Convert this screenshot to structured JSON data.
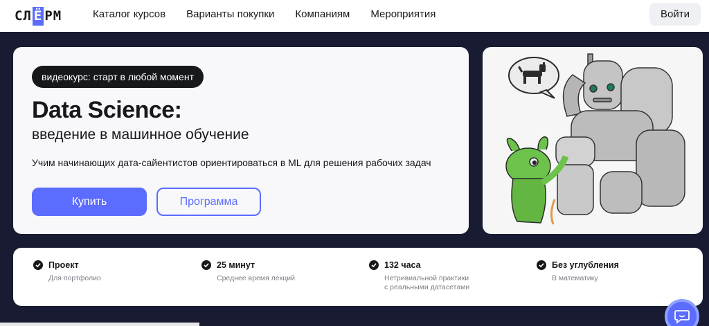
{
  "header": {
    "logo": {
      "pre": "СЛ",
      "hl": "Ё",
      "post": "РМ"
    },
    "nav": [
      "Каталог курсов",
      "Варианты покупки",
      "Компаниям",
      "Мероприятия"
    ],
    "login_label": "Войти"
  },
  "hero": {
    "badge": "видеокурс: старт в любой момент",
    "title": "Data Science:",
    "subtitle": "введение в машинное обучение",
    "description": "Учим начинающих дата-сайентистов ориентироваться в ML для решения рабочих задач",
    "buy_label": "Купить",
    "program_label": "Программа"
  },
  "features": [
    {
      "title": "Проект",
      "line1": "Для портфолио",
      "line2": ""
    },
    {
      "title": "25 минут",
      "line1": "Среднее время лекций",
      "line2": ""
    },
    {
      "title": "132 часа",
      "line1": "Нетривиальной практики",
      "line2": "с реальными датасетами"
    },
    {
      "title": "Без углубления",
      "line1": "В математику",
      "line2": ""
    }
  ],
  "colors": {
    "accent": "#5b6cff",
    "dark": "#181b32",
    "robot": "#bdbdbd",
    "alien": "#6cc24a"
  },
  "icons": {
    "check": "check-circle-icon",
    "chat": "chat-bubble-icon",
    "dog": "dog-icon"
  }
}
